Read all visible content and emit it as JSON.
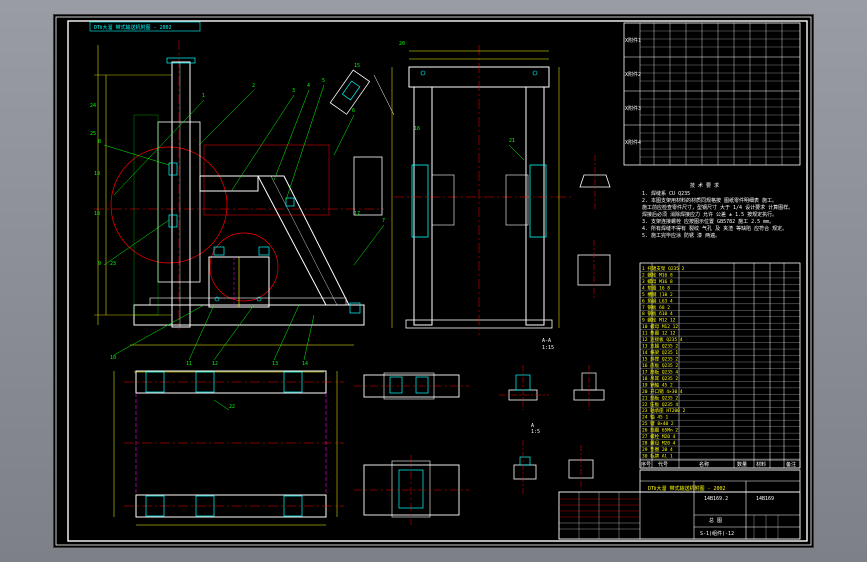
{
  "drawing": {
    "top_title": "DTⅡ大溜  带式输送机附图 - 2002",
    "title_block_name": "DTⅡ大溜  带式输送机附图 - 2002",
    "title_block_code_left": "14B169.2",
    "title_block_code_right": "14B169",
    "title_block_drawing_no": "S-1(组件)-12",
    "title_block_label": "总 图",
    "scale_labels": [
      "1:15",
      "1:5"
    ],
    "section_labels": [
      "A-A",
      "A",
      "B"
    ],
    "tech_notes_title": "技 术 要 求",
    "tech_notes": [
      "1. 焊缝系 CU Q235",
      "2. 本图支架用材料的材质同规格按 图纸零件明细表 施工。",
      "   施工前应检查零件尺寸，型钢尺寸 大于 1/4 设计要求 计算图样。",
      "   焊接后必须 消除焊接应力 允许 公差 ± 1.5 按规定执行。",
      "3. 支架连接螺栓 应按图示位置 GB5782 施工 2.5 mm。",
      "4. 所有焊缝不得有 裂纹 气孔 及 夹渣 等缺陷 应符合 规定。",
      "5. 施工完毕应涂 防锈 漆 两遍。"
    ],
    "side_table_labels": [
      "X附件1",
      "X附件2",
      "X附件3",
      "X附件4"
    ],
    "bom_rows": [
      "1 托辊支架 Q235 2",
      "2 螺栓 M16 8",
      "3 螺母 M16 8",
      "4 垫圈 16 8",
      "5 槽钢 [10 2",
      "6 角钢 L63 4",
      "7 钢板 δ8 2",
      "8 钢板 δ10 4",
      "9 螺栓 M12 12",
      "10 螺母 M12 12",
      "11 垫圈 12 12",
      "12 连接板 Q235 4",
      "13 支腿 Q235 2",
      "14 横梁 Q235 1",
      "15 斜撑 Q235 2",
      "16 底板 Q235 2",
      "17 筋板 Q235 4",
      "18 吊耳 Q235 2",
      "19 销轴 45 2",
      "20 开口销 4×30 4",
      "21 挡板 Q235 2",
      "22 压板 Q235 4",
      "23 轴承座 HT200 2",
      "24 轴 45 1",
      "25 键 8×40 2",
      "26 挡圈 65Mn 2",
      "27 螺栓 M20 4",
      "28 螺母 M20 4",
      "29 垫圈 20 4",
      "30 标牌 Al 1"
    ],
    "bom_header": [
      "序号",
      "代号",
      "名称",
      "数量",
      "材料",
      "备注"
    ],
    "leader_numbers": [
      "1",
      "2",
      "3",
      "4",
      "5",
      "6",
      "7",
      "8",
      "9",
      "10",
      "11",
      "12",
      "13",
      "14",
      "15",
      "16",
      "17",
      "18",
      "19",
      "20",
      "21",
      "22",
      "23",
      "24",
      "25"
    ],
    "colors": {
      "background": "#000000",
      "frame": "#ffffff",
      "outline": "#ffffff",
      "centerline": "#ff0000",
      "dimension": "#00ff00",
      "part": "#ffff00",
      "hidden": "#ff00ff",
      "annotation": "#00ffff"
    }
  }
}
